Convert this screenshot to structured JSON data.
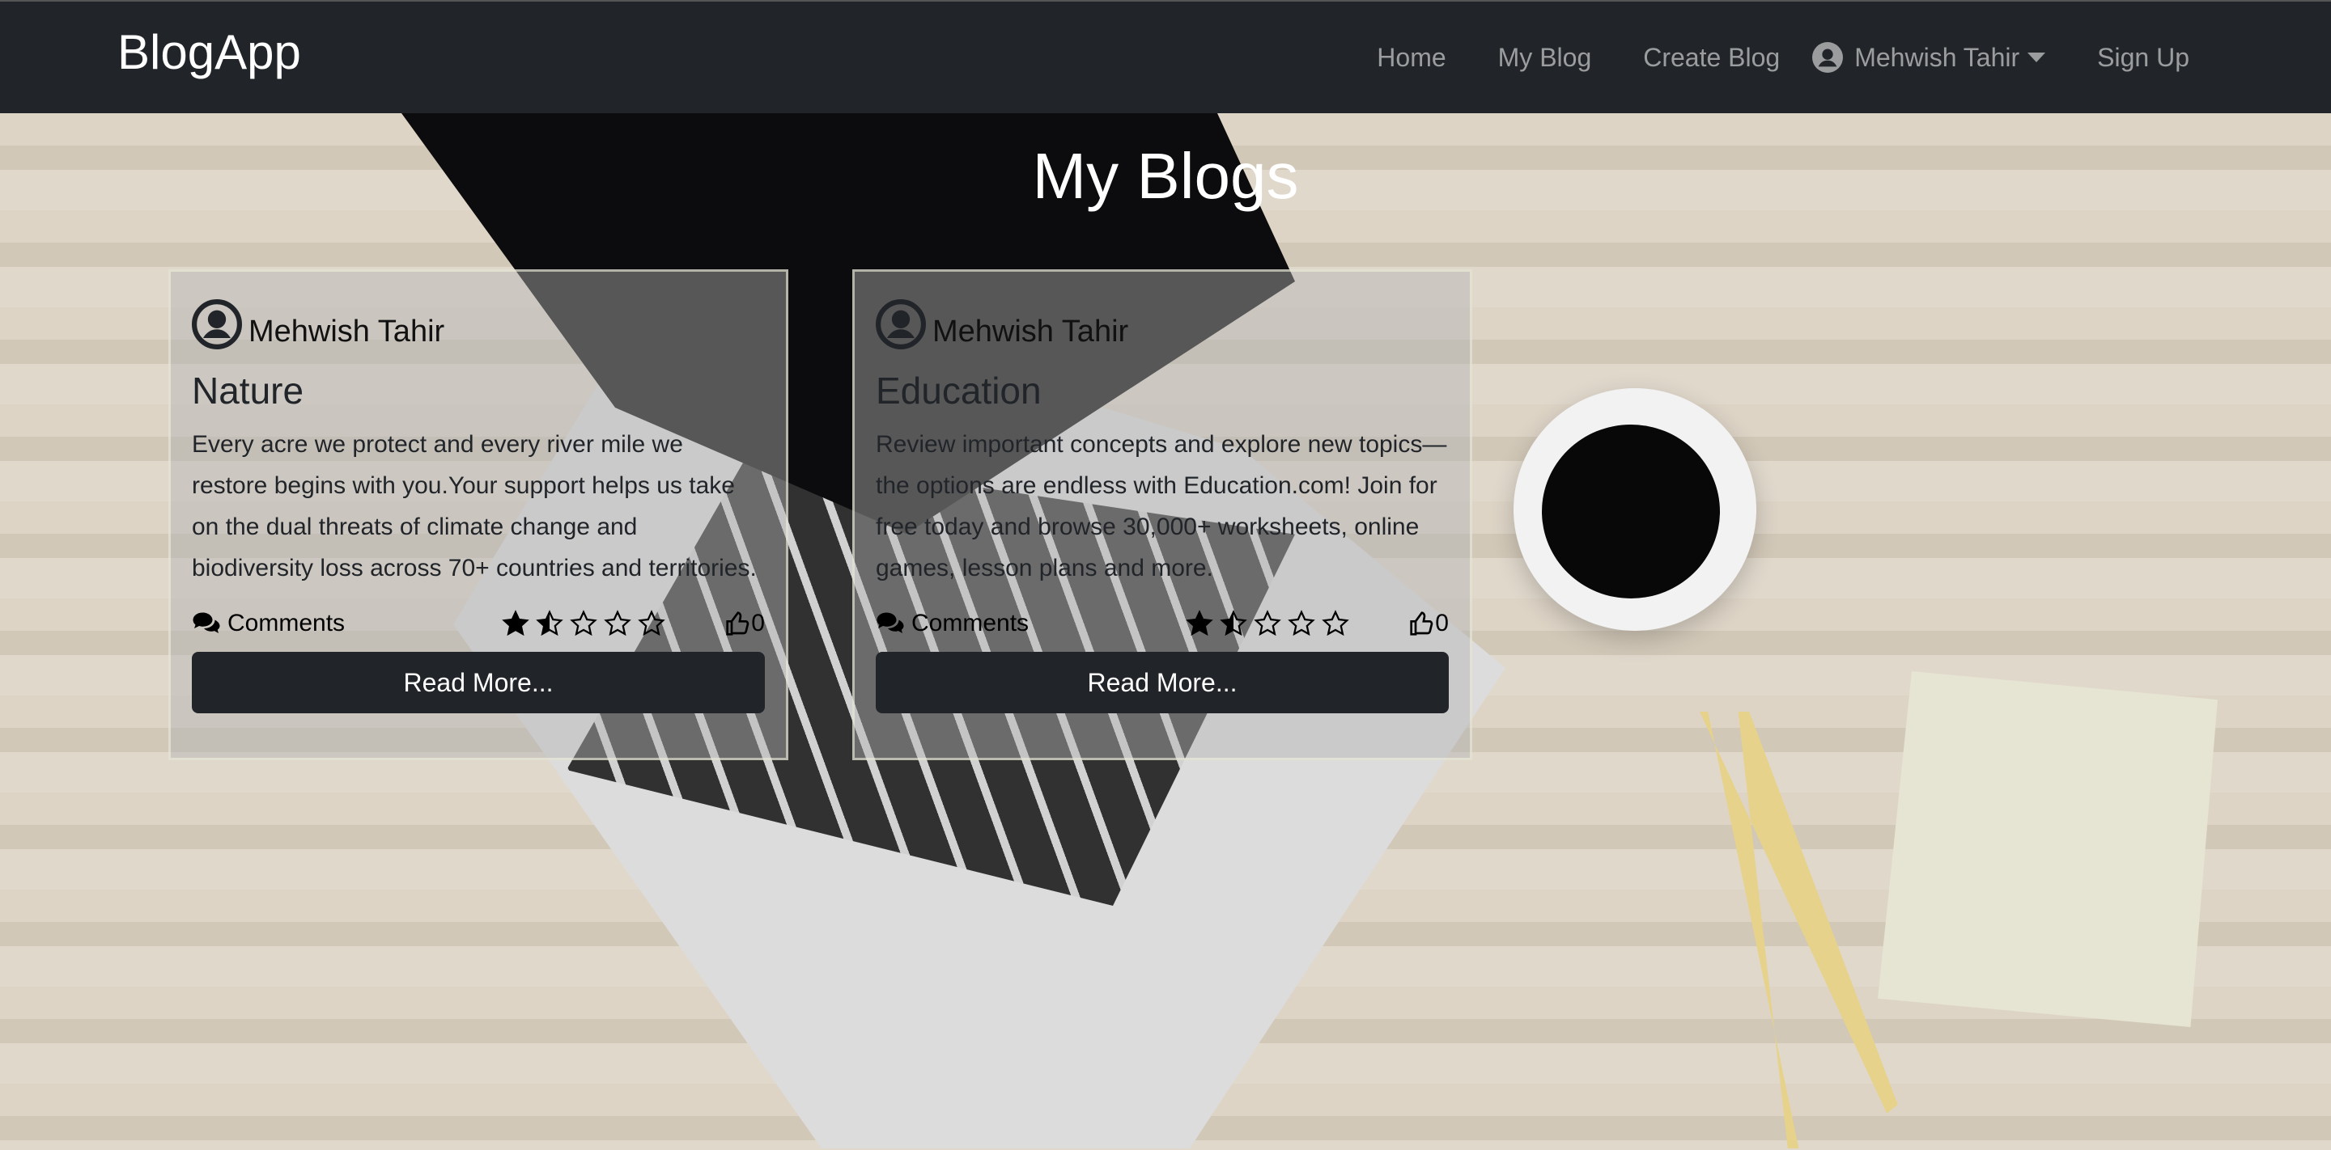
{
  "nav": {
    "brand": "BlogApp",
    "links": [
      "Home",
      "My Blog",
      "Create Blog"
    ],
    "user": "Mehwish Tahir",
    "signup": "Sign Up"
  },
  "page_title": "My Blogs",
  "cards": [
    {
      "author": "Mehwish Tahir",
      "title": "Nature",
      "body": "Every acre we protect and every river mile we restore begins with you.Your support helps us take on the dual threats of climate change and biodiversity loss across 70+ countries and territories.",
      "comments": "Comments",
      "rating": 1.5,
      "likes": "0",
      "button": "Read More..."
    },
    {
      "author": "Mehwish Tahir",
      "title": "Education",
      "body": "Review important concepts and explore new topics—the options are endless with Education.com! Join for free today and browse 30,000+ worksheets, online games, lesson plans and more.",
      "comments": "Comments",
      "rating": 1.5,
      "likes": "0",
      "button": "Read More..."
    }
  ]
}
